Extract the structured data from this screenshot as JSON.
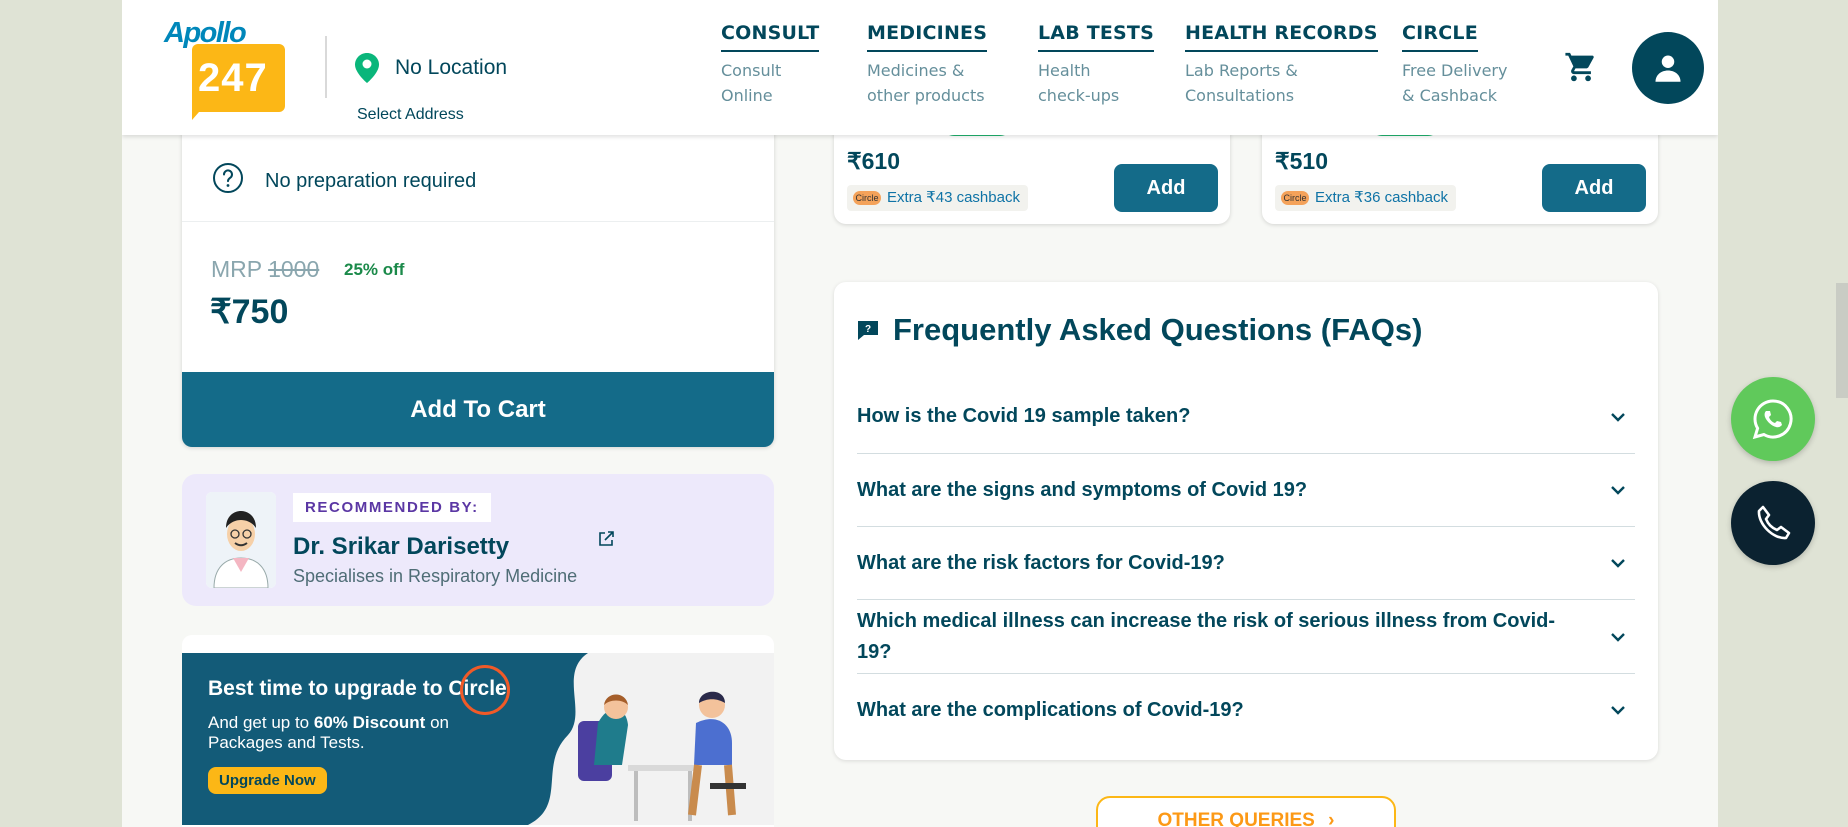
{
  "header": {
    "logo_top": "Apollo",
    "logo_num": "247",
    "location": "No Location",
    "select_address": "Select Address",
    "nav": [
      {
        "title": "CONSULT",
        "sub": "Consult\nOnline"
      },
      {
        "title": "MEDICINES",
        "sub": "Medicines &\nother products"
      },
      {
        "title": "LAB TESTS",
        "sub": "Health\ncheck-ups"
      },
      {
        "title": "HEALTH RECORDS",
        "sub": "Lab Reports &\nConsultations"
      },
      {
        "title": "CIRCLE",
        "sub": "Free Delivery\n& Cashback"
      }
    ]
  },
  "product": {
    "prep": "No preparation required",
    "mrp_label": "MRP",
    "mrp_value": "1000",
    "discount": "25% off",
    "price": "₹750",
    "add_to_cart": "Add To Cart"
  },
  "recommendation": {
    "tag": "RECOMMENDED BY:",
    "doctor": "Dr. Srikar Darisetty",
    "speciality": "Specialises in Respiratory Medicine"
  },
  "banner": {
    "title": "Best time to upgrade to Circle",
    "sub_pre": "And get up to ",
    "sub_bold": "60% Discount",
    "sub_post": " on Packages and Tests.",
    "button": "Upgrade Now"
  },
  "cards": [
    {
      "price": "₹610",
      "cashback": "Extra ₹43 cashback",
      "add": "Add",
      "badge": "Circle"
    },
    {
      "price": "₹510",
      "cashback": "Extra ₹36 cashback",
      "add": "Add",
      "badge": "Circle"
    }
  ],
  "faq": {
    "title": "Frequently Asked Questions (FAQs)",
    "items": [
      "How is the Covid 19 sample taken?",
      "What are the signs and symptoms of Covid 19?",
      "What are the risk factors for Covid-19?",
      "Which medical illness can increase the risk of serious illness from Covid-19?",
      "What are the complications of Covid-19?"
    ],
    "other_queries": "OTHER QUERIES"
  },
  "colors": {
    "brand_dark": "#02475b",
    "button_teal": "#146b89",
    "accent_orange": "#fcb716",
    "whatsapp": "#60c95b"
  }
}
